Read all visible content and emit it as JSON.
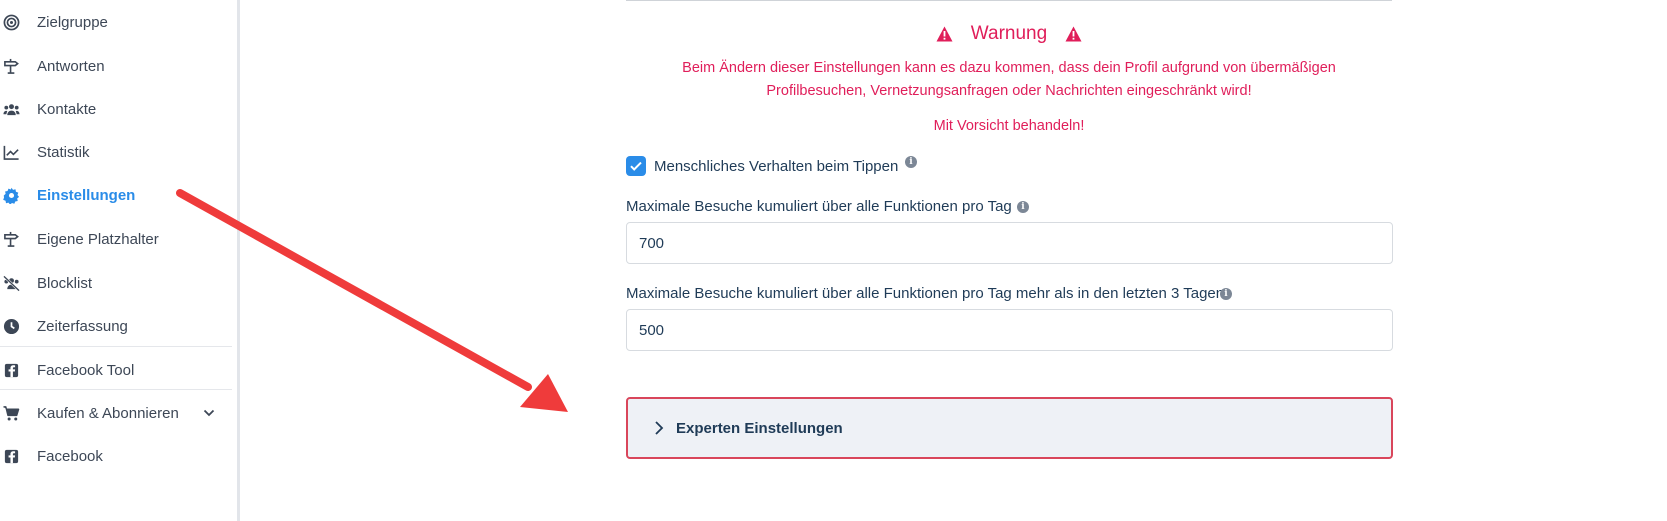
{
  "sidebar": {
    "items": [
      {
        "label": "Zielgruppe",
        "icon": "target-icon"
      },
      {
        "label": "Antworten",
        "icon": "signpost-icon"
      },
      {
        "label": "Kontakte",
        "icon": "users-icon"
      },
      {
        "label": "Statistik",
        "icon": "line-chart-icon"
      },
      {
        "label": "Einstellungen",
        "icon": "gear-icon",
        "active": true
      },
      {
        "label": "Eigene Platzhalter",
        "icon": "signpost-icon"
      },
      {
        "label": "Blocklist",
        "icon": "users-slash-icon"
      },
      {
        "label": "Zeiterfassung",
        "icon": "clock-icon"
      },
      {
        "label": "Facebook Tool",
        "icon": "facebook-square-icon"
      },
      {
        "label": "Kaufen & Abonnieren",
        "icon": "cart-icon",
        "has_chevron": true
      },
      {
        "label": "Facebook",
        "icon": "facebook-square-icon"
      }
    ]
  },
  "warning": {
    "title": "Warnung",
    "message_line1": "Beim Ändern dieser Einstellungen kann es dazu kommen, dass dein Profil aufgrund von übermäßigen",
    "message_line2": "Profilbesuchen, Vernetzungsanfragen oder Nachrichten eingeschränkt wird!",
    "careful": "Mit Vorsicht behandeln!"
  },
  "settings": {
    "human_typing": {
      "label": "Menschliches Verhalten beim Tippen",
      "checked": true
    },
    "max_visits": {
      "label": "Maximale Besuche kumuliert über alle Funktionen pro Tag",
      "value": "700"
    },
    "max_visits_increase": {
      "label": "Maximale Besuche kumuliert über alle Funktionen pro Tag mehr als in den letzten 3 Tagen",
      "value": "500"
    },
    "expert": {
      "label": "Experten Einstellungen"
    }
  },
  "colors": {
    "accent": "#2a8ce8",
    "warning": "#e01e5a",
    "text": "#1f3b57",
    "annotation_arrow": "#ef3b3b"
  }
}
